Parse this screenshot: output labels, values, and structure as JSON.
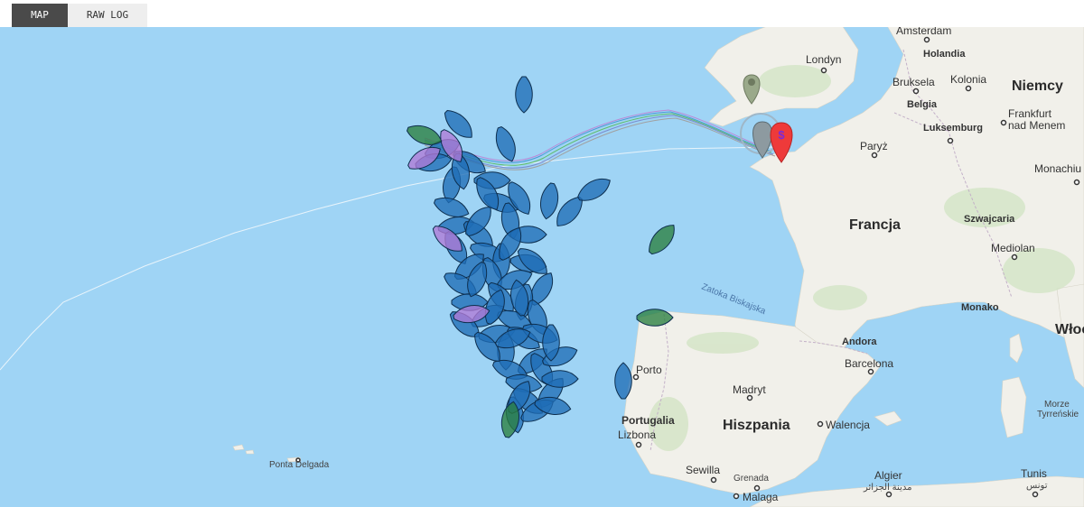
{
  "tabs": [
    {
      "label": "MAP",
      "active": true
    },
    {
      "label": "RAW LOG",
      "active": false
    }
  ],
  "colors": {
    "water": "#9fd4f5",
    "land": "#f1f0ea",
    "boat_blue": "#1f6db6",
    "boat_green": "#2a7f3f",
    "boat_purple": "#b07ad6",
    "marker_red": "#ee3a3a",
    "marker_grey": "#8d9aa0"
  },
  "map": {
    "labels": {
      "amsterdam": "Amsterdam",
      "holandia": "Holandia",
      "londyn": "Londyn",
      "bruksela": "Bruksela",
      "kolonia": "Kolonia",
      "niemcy": "Niemcy",
      "belgia": "Belgia",
      "frankfurt1": "Frankfurt",
      "frankfurt2": "nad Menem",
      "luksemburg": "Luksemburg",
      "paryz": "Paryż",
      "monachium": "Monachiu",
      "francja": "Francja",
      "szwajcaria": "Szwajcaria",
      "mediolan": "Mediolan",
      "zatoka": "Zatoka Biskajska",
      "monako": "Monako",
      "wlochy": "Włoc",
      "andora": "Andora",
      "barcelona": "Barcelona",
      "porto": "Porto",
      "madryt": "Madryt",
      "portugalia": "Portugalia",
      "hiszpania": "Hiszpania",
      "walencja": "Walencja",
      "lizbona": "Lizbona",
      "morze1": "Morze",
      "morze2": "Tyrreńskie",
      "sewilla": "Sewilla",
      "grenada": "Grenada",
      "malaga": "Malaga",
      "algier": "Algier",
      "algier_ar": "مدينة الجزائر",
      "tunis": "Tunis",
      "tunis_ar": "تونس",
      "ponta_delgada": "Ponta Delgada"
    },
    "marker_symbol": "$",
    "markers": [
      {
        "kind": "finish",
        "icon": "map-pin-icon",
        "color": "#ee3a3a"
      },
      {
        "kind": "waypoint",
        "icon": "map-pin-icon",
        "color": "#8d9aa0"
      },
      {
        "kind": "waypoint",
        "icon": "map-pin-icon",
        "color": "#9aa98a"
      }
    ],
    "fleet": {
      "boats_blue_count": 62,
      "boats_green_count": 4,
      "boats_purple_count": 4
    }
  }
}
